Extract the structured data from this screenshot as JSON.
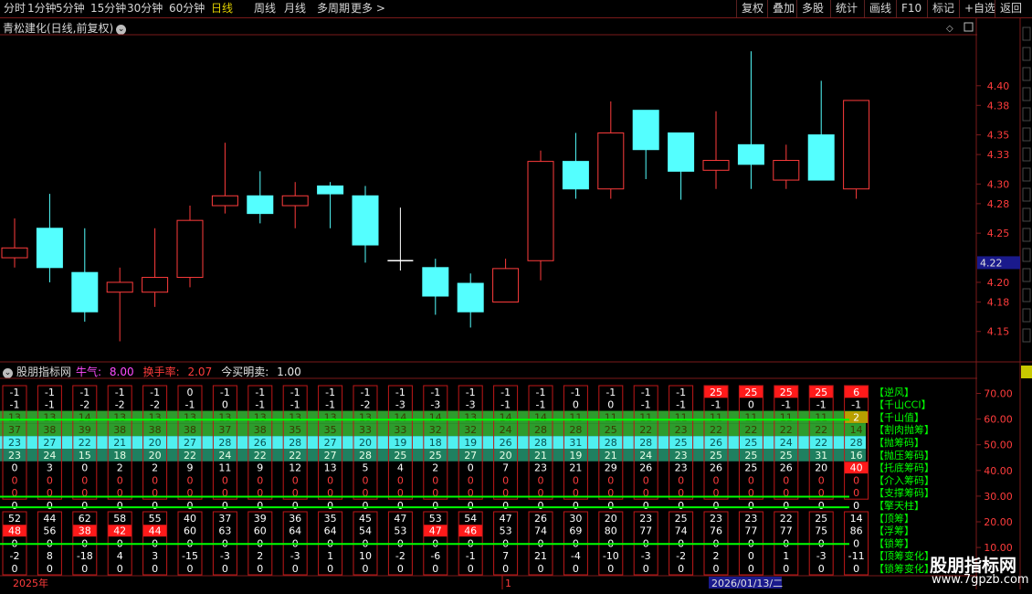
{
  "toolbar": {
    "left_items": [
      {
        "label": "分时",
        "active": false
      },
      {
        "label": "1分钟",
        "active": false
      },
      {
        "label": "5分钟",
        "active": false
      },
      {
        "label": "15分钟",
        "active": false
      },
      {
        "label": "30分钟",
        "active": false
      },
      {
        "label": "60分钟",
        "active": false
      },
      {
        "label": "日线",
        "active": true
      },
      {
        "label": "周线",
        "active": false
      },
      {
        "label": "月线",
        "active": false
      },
      {
        "label": "多周期",
        "active": false
      },
      {
        "label": "更多 >",
        "active": false
      }
    ],
    "right_items": [
      "复权",
      "叠加",
      "多股",
      "统计",
      "画线",
      "F10",
      "标记",
      "+自选",
      "返回"
    ]
  },
  "main_chart": {
    "title": "青松建化(日线,前复权)",
    "current_price": "4.22",
    "y_ticks": [
      "4.40",
      "4.38",
      "4.35",
      "4.33",
      "4.30",
      "4.28",
      "4.25",
      "4.20",
      "4.18",
      "4.15"
    ]
  },
  "indicator": {
    "name": "股朋指标网",
    "bull_label": "牛气:",
    "bull_value": "8.00",
    "turnover_label": "换手率:",
    "turnover_value": "2.07",
    "buy_label": "今买明卖:",
    "buy_value": "1.00",
    "y_ticks": [
      "70.00",
      "60.00",
      "50.00",
      "40.00",
      "30.00",
      "20.00",
      "10.00"
    ],
    "legend": [
      "【逆风】",
      "【千山CCI】",
      "【千山值】",
      "【割肉抛筹】",
      "【抛筹码】",
      "【抛压筹码】",
      "【托底筹码】",
      "【介入筹码】",
      "【支撑筹码】",
      "【擎天柱】",
      "【顶筹】",
      "【浮筹】",
      "【锁筹】",
      "【顶筹变化】",
      "【锁筹变化】"
    ]
  },
  "chart_data": {
    "type": "candlestick",
    "title": "青松建化(日线,前复权)",
    "ylim": [
      4.12,
      4.45
    ],
    "candles": [
      {
        "o": 4.225,
        "c": 4.235,
        "h": 4.265,
        "l": 4.215
      },
      {
        "o": 4.255,
        "c": 4.215,
        "h": 4.29,
        "l": 4.2
      },
      {
        "o": 4.21,
        "c": 4.17,
        "h": 4.255,
        "l": 4.16
      },
      {
        "o": 4.19,
        "c": 4.2,
        "h": 4.215,
        "l": 4.14
      },
      {
        "o": 4.19,
        "c": 4.205,
        "h": 4.255,
        "l": 4.175
      },
      {
        "o": 4.205,
        "c": 4.263,
        "h": 4.278,
        "l": 4.195
      },
      {
        "o": 4.278,
        "c": 4.288,
        "h": 4.342,
        "l": 4.27
      },
      {
        "o": 4.288,
        "c": 4.27,
        "h": 4.313,
        "l": 4.26
      },
      {
        "o": 4.278,
        "c": 4.288,
        "h": 4.302,
        "l": 4.255
      },
      {
        "o": 4.298,
        "c": 4.29,
        "h": 4.302,
        "l": 4.255
      },
      {
        "o": 4.288,
        "c": 4.238,
        "h": 4.298,
        "l": 4.22
      },
      {
        "o": 4.222,
        "c": 4.222,
        "h": 4.276,
        "l": 4.212
      },
      {
        "o": 4.215,
        "c": 4.186,
        "h": 4.224,
        "l": 4.167
      },
      {
        "o": 4.199,
        "c": 4.17,
        "h": 4.209,
        "l": 4.154
      },
      {
        "o": 4.18,
        "c": 4.214,
        "h": 4.224,
        "l": 4.18
      },
      {
        "o": 4.222,
        "c": 4.323,
        "h": 4.334,
        "l": 4.202
      },
      {
        "o": 4.323,
        "c": 4.295,
        "h": 4.352,
        "l": 4.285
      },
      {
        "o": 4.295,
        "c": 4.352,
        "h": 4.384,
        "l": 4.285
      },
      {
        "o": 4.375,
        "c": 4.335,
        "h": 4.375,
        "l": 4.305
      },
      {
        "o": 4.352,
        "c": 4.313,
        "h": 4.352,
        "l": 4.284
      },
      {
        "o": 4.314,
        "c": 4.324,
        "h": 4.374,
        "l": 4.295
      },
      {
        "o": 4.34,
        "c": 4.32,
        "h": 4.435,
        "l": 4.295
      },
      {
        "o": 4.304,
        "c": 4.324,
        "h": 4.34,
        "l": 4.295
      },
      {
        "o": 4.35,
        "c": 4.304,
        "h": 4.405,
        "l": 4.304
      },
      {
        "o": 4.295,
        "c": 4.385,
        "h": 4.385,
        "l": 4.285
      }
    ],
    "indicator_grid": {
      "columns": 25,
      "rows": [
        [
          "-1",
          "-1",
          "-1",
          "-1",
          "-1",
          "0",
          "-1",
          "-1",
          "-1",
          "-1",
          "-1",
          "-1",
          "-1",
          "-1",
          "-1",
          "-1",
          "-1",
          "-1",
          "-1",
          "-1",
          "25",
          "25",
          "25",
          "25",
          "6"
        ],
        [
          "-1",
          "-1",
          "-2",
          "-2",
          "-2",
          "-1",
          "0",
          "-1",
          "-1",
          "-1",
          "-2",
          "-3",
          "-3",
          "-3",
          "-1",
          "-1",
          "0",
          "0",
          "-1",
          "-1",
          "-1",
          "0",
          "-1",
          "-1",
          "-1"
        ],
        [
          "13",
          "13",
          "14",
          "13",
          "13",
          "13",
          "13",
          "13",
          "13",
          "13",
          "13",
          "14",
          "14",
          "13",
          "14",
          "14",
          "11",
          "11",
          "11",
          "11",
          "11",
          "11",
          "11",
          "11",
          "2"
        ],
        [
          "37",
          "38",
          "39",
          "38",
          "38",
          "38",
          "37",
          "38",
          "35",
          "35",
          "33",
          "33",
          "32",
          "32",
          "24",
          "28",
          "28",
          "25",
          "22",
          "23",
          "22",
          "22",
          "22",
          "22",
          "14"
        ],
        [
          "23",
          "27",
          "22",
          "21",
          "20",
          "27",
          "28",
          "26",
          "28",
          "27",
          "20",
          "19",
          "18",
          "19",
          "26",
          "28",
          "31",
          "28",
          "28",
          "25",
          "26",
          "25",
          "24",
          "22",
          "28"
        ],
        [
          "23",
          "24",
          "15",
          "18",
          "20",
          "22",
          "24",
          "22",
          "22",
          "27",
          "28",
          "25",
          "25",
          "27",
          "20",
          "21",
          "19",
          "21",
          "24",
          "23",
          "25",
          "25",
          "25",
          "31",
          "16"
        ],
        [
          "0",
          "3",
          "0",
          "2",
          "2",
          "9",
          "11",
          "9",
          "12",
          "13",
          "5",
          "4",
          "2",
          "0",
          "7",
          "23",
          "21",
          "29",
          "26",
          "23",
          "26",
          "25",
          "26",
          "20",
          "40"
        ],
        [
          "0",
          "0",
          "0",
          "0",
          "0",
          "0",
          "0",
          "0",
          "0",
          "0",
          "0",
          "0",
          "0",
          "0",
          "0",
          "0",
          "0",
          "0",
          "0",
          "0",
          "0",
          "0",
          "0",
          "0",
          "0"
        ],
        [
          "0",
          "0",
          "0",
          "0",
          "0",
          "0",
          "0",
          "0",
          "0",
          "0",
          "0",
          "0",
          "0",
          "0",
          "0",
          "0",
          "0",
          "0",
          "0",
          "0",
          "0",
          "0",
          "0",
          "0",
          "0"
        ],
        [
          "0",
          "0",
          "0",
          "0",
          "0",
          "0",
          "0",
          "0",
          "0",
          "0",
          "0",
          "0",
          "0",
          "0",
          "0",
          "0",
          "0",
          "0",
          "0",
          "0",
          "0",
          "0",
          "0",
          "0",
          "0"
        ],
        [
          "52",
          "44",
          "62",
          "58",
          "55",
          "40",
          "37",
          "39",
          "36",
          "35",
          "45",
          "47",
          "53",
          "54",
          "47",
          "26",
          "30",
          "20",
          "23",
          "25",
          "23",
          "23",
          "22",
          "25",
          "14"
        ],
        [
          "48",
          "56",
          "38",
          "42",
          "44",
          "60",
          "63",
          "60",
          "64",
          "64",
          "54",
          "53",
          "47",
          "46",
          "53",
          "74",
          "69",
          "80",
          "77",
          "74",
          "76",
          "77",
          "77",
          "75",
          "86"
        ],
        [
          "0",
          "0",
          "0",
          "0",
          "0",
          "0",
          "0",
          "0",
          "0",
          "0",
          "0",
          "0",
          "0",
          "0",
          "0",
          "0",
          "0",
          "0",
          "0",
          "0",
          "0",
          "0",
          "0",
          "0",
          "0"
        ],
        [
          "-2",
          "8",
          "-18",
          "4",
          "3",
          "-15",
          "-3",
          "2",
          "-3",
          "1",
          "10",
          "-2",
          "-6",
          "-1",
          "7",
          "21",
          "-4",
          "-10",
          "-3",
          "-2",
          "2",
          "0",
          "1",
          "-3",
          "-11"
        ],
        [
          "0",
          "0",
          "0",
          "0",
          "0",
          "0",
          "0",
          "0",
          "0",
          "0",
          "0",
          "0",
          "0",
          "0",
          "0",
          "0",
          "0",
          "0",
          "0",
          "0",
          "0",
          "0",
          "0",
          "0",
          "0"
        ]
      ]
    },
    "x_date_labels": [
      "2025年",
      "1",
      "2026/01/13/二"
    ]
  },
  "watermark": {
    "big": "股朋指标网",
    "small": "www.7gpzb.com"
  },
  "colors": {
    "up": "#ff3c3c",
    "down": "#54ffff",
    "grid": "#7a1a1a",
    "highlight_red": "#ff1a1a",
    "band_green": "#2d9c2d",
    "band_cyan": "#4ff0f0",
    "band_teal": "#1f8060",
    "line_green": "#00ff00"
  }
}
